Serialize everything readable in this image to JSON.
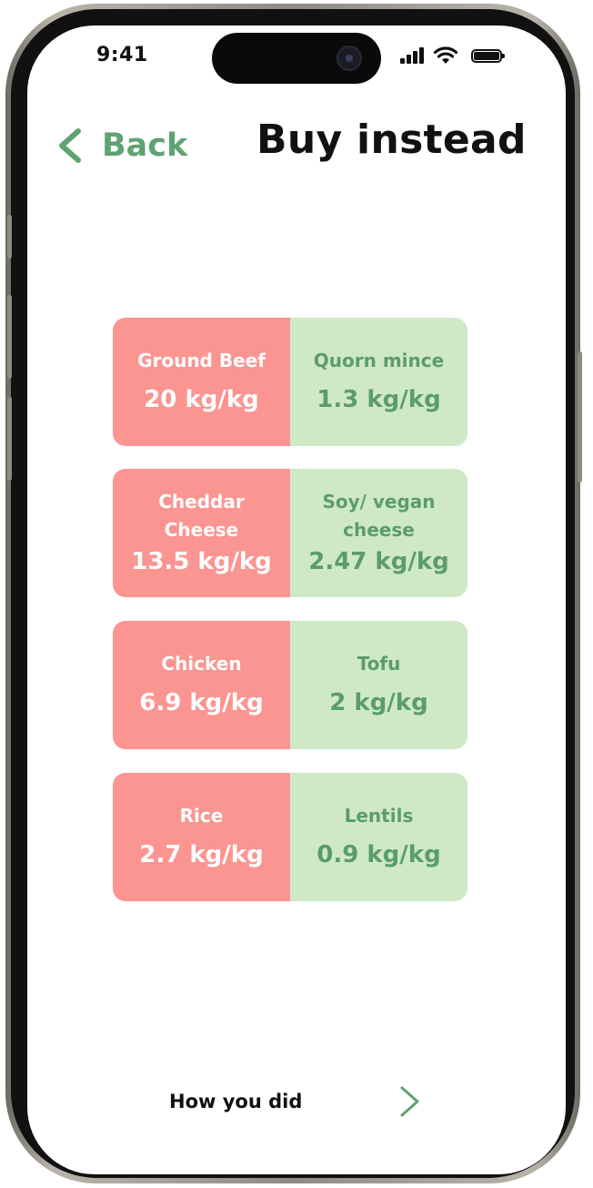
{
  "status_bar": {
    "time": "9:41"
  },
  "header": {
    "back_label": "Back",
    "title": "Buy instead"
  },
  "swaps": [
    {
      "from": "Ground Beef",
      "from_value": "20 kg/kg",
      "to": "Quorn mince",
      "to_value": "1.3 kg/kg"
    },
    {
      "from": "Cheddar Cheese",
      "from_value": "13.5 kg/kg",
      "to": "Soy/ vegan cheese",
      "to_value": "2.47 kg/kg"
    },
    {
      "from": "Chicken",
      "from_value": "6.9 kg/kg",
      "to": "Tofu",
      "to_value": "2 kg/kg"
    },
    {
      "from": "Rice",
      "from_value": "2.7 kg/kg",
      "to": "Lentils",
      "to_value": "0.9 kg/kg"
    }
  ],
  "footer": {
    "next_label": "How you did"
  },
  "colors": {
    "accent_green": "#5fa372",
    "high_emission_bg": "#fa9591",
    "low_emission_bg": "#cfe9c7"
  },
  "icons": {
    "back": "chevron-left-icon",
    "next": "arrow-right-icon",
    "signal": "signal-icon",
    "wifi": "wifi-icon",
    "battery": "battery-icon"
  }
}
